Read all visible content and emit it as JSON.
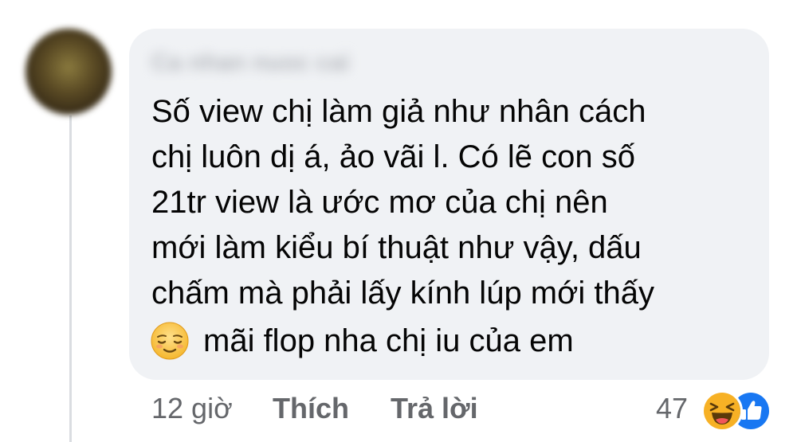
{
  "comment": {
    "author_name": "Ca nhan nuoc cai",
    "text_lines": [
      "Số view chị làm giả như nhân cách",
      "chị luôn dị á, ảo vãi l. Có lẽ con số",
      "21tr view là ước mơ của chị nên",
      "mới làm kiểu bí thuật như vậy, dấu",
      "chấm mà phải lấy kính lúp mới thấy"
    ],
    "last_line_emoji": "relieved-face-emoji",
    "last_line_text": "mãi flop nha chị iu của em"
  },
  "meta": {
    "time": "12 giờ",
    "like_label": "Thích",
    "reply_label": "Trả lời"
  },
  "reactions": {
    "count": "47",
    "types": [
      "haha-reaction-icon",
      "like-reaction-icon"
    ],
    "colors": {
      "haha": "#f7b125",
      "like": "#1877f2"
    }
  }
}
